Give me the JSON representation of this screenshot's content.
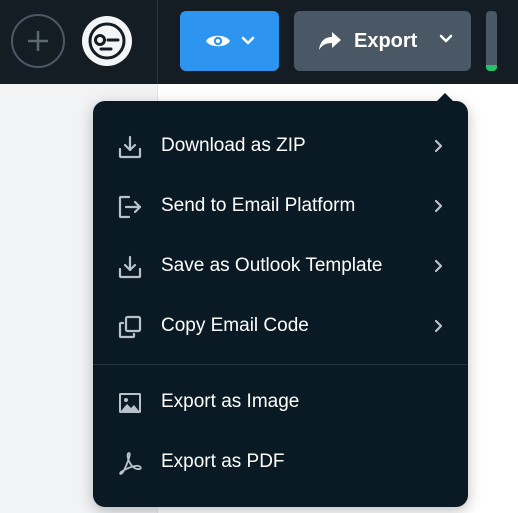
{
  "toolbar": {
    "add_icon": "plus-circle-icon",
    "avatar_icon": "avatar-face-icon",
    "preview_icon": "eye-icon",
    "export_label": "Export",
    "export_icon": "share-arrow-icon"
  },
  "export_menu": {
    "items": [
      {
        "label": "Download as ZIP",
        "icon": "download-icon",
        "has_submenu": true
      },
      {
        "label": "Send to Email Platform",
        "icon": "sign-out-icon",
        "has_submenu": true
      },
      {
        "label": "Save as Outlook Template",
        "icon": "download-icon",
        "has_submenu": true
      },
      {
        "label": "Copy Email Code",
        "icon": "copy-icon",
        "has_submenu": true
      },
      {
        "label": "Export as Image",
        "icon": "image-icon",
        "has_submenu": false
      },
      {
        "label": "Export as PDF",
        "icon": "pdf-icon",
        "has_submenu": false
      }
    ]
  },
  "colors": {
    "toolbar_bg": "#141c24",
    "preview_button": "#2d95f0",
    "export_button": "#4a5865",
    "menu_bg": "#0a1a25",
    "status_green": "#24c26a"
  }
}
